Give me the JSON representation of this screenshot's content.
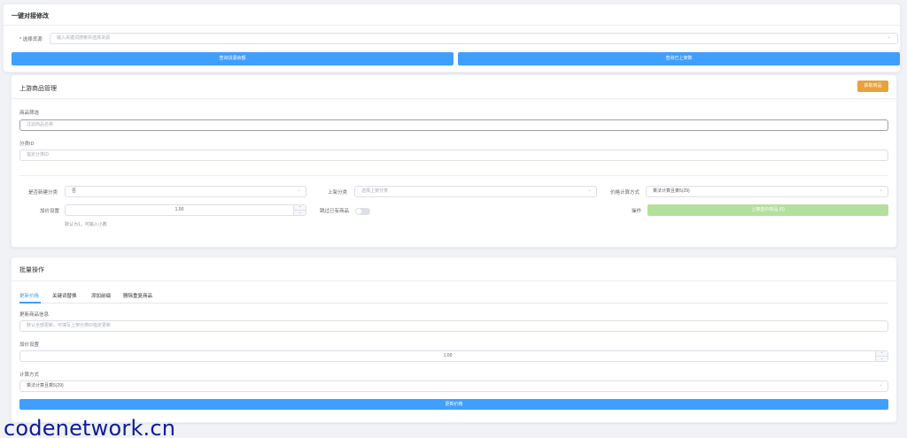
{
  "section_title": "一键对接修改",
  "source": {
    "label": "* 选择货源",
    "placeholder": "输入关键词搜索并选择货源"
  },
  "buttons": {
    "query_balance": "查询货源余额",
    "query_listed": "查询已上架数"
  },
  "upstream": {
    "title": "上游商品管理",
    "fetch_btn": "获取商品",
    "filter_label": "商品筛选",
    "filter_placeholder": "过滤商品名称",
    "category_label": "分类ID",
    "category_placeholder": "指定分类ID",
    "new_category_label": "是否新建分类",
    "new_category_value": "否",
    "listing_category_label": "上架分类",
    "listing_category_placeholder": "选择上架分类",
    "price_method_label": "价格计算方式",
    "price_method_value": "乘法计算且乘5(29)",
    "markup_label": "加价设置",
    "markup_value": "1.00",
    "markup_hint": "默认为1，可输入小数",
    "skip_label": "跳过已有商品",
    "action_label": "操作",
    "action_btn": "上架选中商品 (0)"
  },
  "batch": {
    "title": "批量操作",
    "tabs": [
      "更新价格",
      "关键词替换",
      "添加前缀",
      "删除重复商品"
    ],
    "update_label": "更新商品信息",
    "update_placeholder": "默认全部更新，可填写上架分类ID指定更新",
    "markup_label": "加价设置",
    "markup_value": "1.00",
    "method_label": "计算方式",
    "method_value": "乘法计算且乘5(29)",
    "submit_btn": "更新价格"
  },
  "watermark": "codenetwork.cn",
  "colors": {
    "primary": "#409eff",
    "success_light": "#b3e19d",
    "warning": "#e6a23c",
    "watermark": "#0d1c9a"
  }
}
